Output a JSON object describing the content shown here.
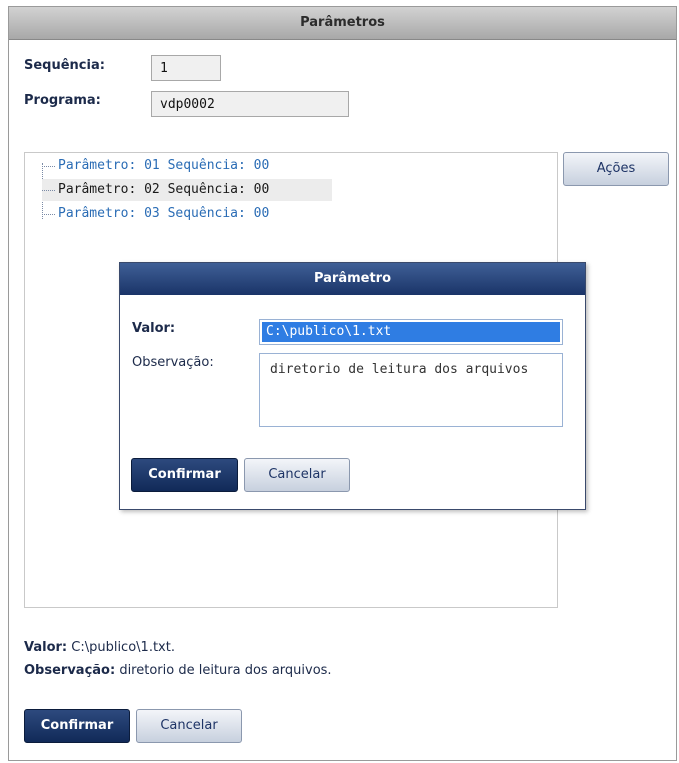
{
  "window": {
    "title": "Parâmetros"
  },
  "form": {
    "sequencia_label": "Sequência:",
    "sequencia_value": "1",
    "programa_label": "Programa:",
    "programa_value": "vdp0002"
  },
  "tree": {
    "items": [
      {
        "label": "Parâmetro: 01 Sequência: 00",
        "selected": false
      },
      {
        "label": "Parâmetro: 02 Sequência: 00",
        "selected": true
      },
      {
        "label": "Parâmetro: 03 Sequência: 00",
        "selected": false
      }
    ]
  },
  "actions_button": "Ações",
  "dialog": {
    "title": "Parâmetro",
    "valor_label": "Valor:",
    "valor_value": "C:\\publico\\1.txt",
    "observacao_label": "Observação:",
    "observacao_value": "diretorio de leitura dos arquivos",
    "confirm_label": "Confirmar",
    "cancel_label": "Cancelar"
  },
  "summary": {
    "valor_label": "Valor:",
    "valor_value": " C:\\publico\\1.txt.",
    "observacao_label": "Observação:",
    "observacao_value": " diretorio de leitura dos arquivos."
  },
  "footer": {
    "confirm_label": "Confirmar",
    "cancel_label": "Cancelar"
  }
}
